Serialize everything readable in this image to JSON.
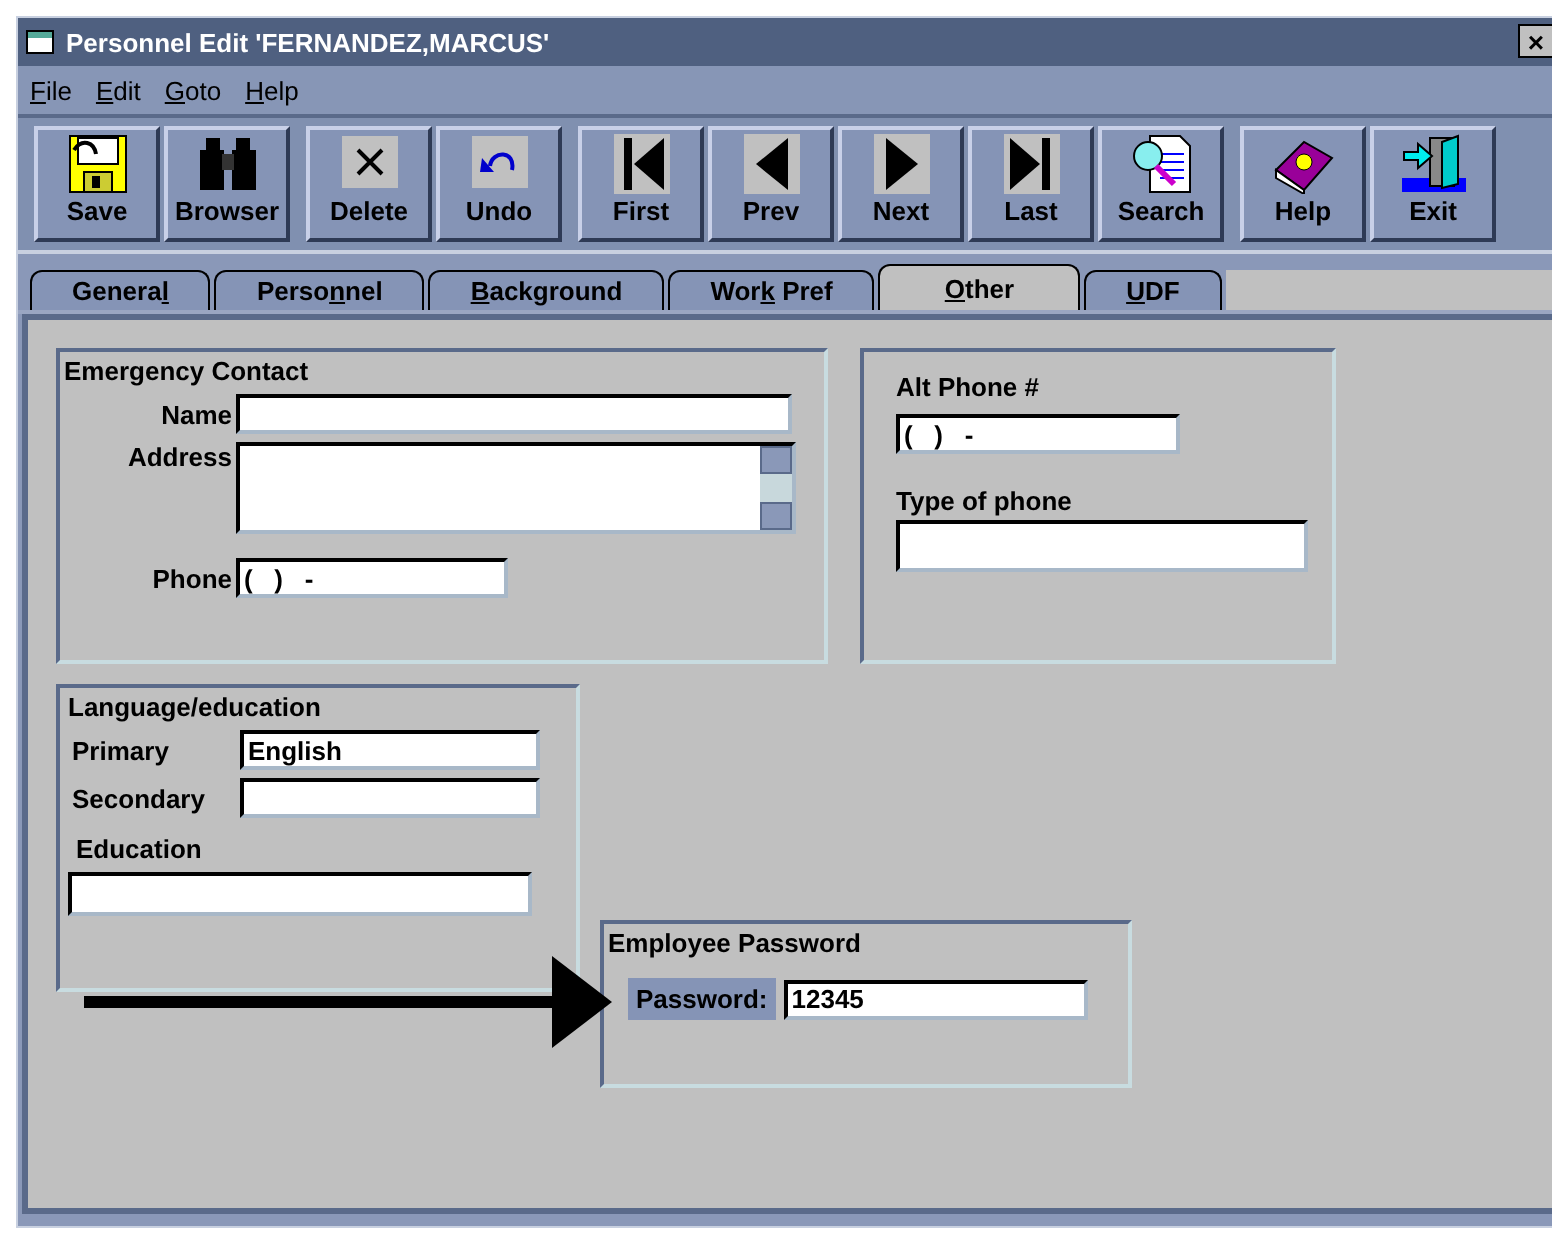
{
  "window": {
    "title": "Personnel Edit 'FERNANDEZ,MARCUS'",
    "close": "×"
  },
  "menu": [
    {
      "label": {
        "key": "F",
        "after": "ile"
      }
    },
    {
      "label": {
        "key": "E",
        "after": "dit"
      }
    },
    {
      "label": {
        "key": "G",
        "after": "oto"
      }
    },
    {
      "label": {
        "key": "H",
        "after": "elp"
      }
    }
  ],
  "toolbar": [
    [
      {
        "label": "Save",
        "kind": "save"
      },
      {
        "label": "Browser",
        "kind": "browse"
      }
    ],
    [
      {
        "label": "Delete",
        "kind": "delete"
      },
      {
        "label": "Undo",
        "kind": "undo"
      }
    ],
    [
      {
        "label": "First",
        "kind": "first"
      },
      {
        "label": "Prev",
        "kind": "prev"
      },
      {
        "label": "Next",
        "kind": "next"
      },
      {
        "label": "Last",
        "kind": "last"
      },
      {
        "label": "Search",
        "kind": "search"
      }
    ],
    [
      {
        "label": "Help",
        "kind": "help"
      },
      {
        "label": "Exit",
        "kind": "exit"
      }
    ]
  ],
  "tabs": [
    {
      "label": {
        "before": "Genera",
        "key": "l"
      },
      "selected": false
    },
    {
      "label": {
        "before": "Perso",
        "key": "n",
        "after": "nel"
      },
      "selected": false
    },
    {
      "label": {
        "key": "B",
        "after": "ackground"
      },
      "selected": false
    },
    {
      "label": {
        "before": "Wor",
        "key": "k",
        "after": " Pref"
      },
      "selected": false
    },
    {
      "label": {
        "key": "O",
        "after": "ther"
      },
      "selected": true
    },
    {
      "label": {
        "key": "U",
        "after": "DF"
      },
      "selected": false
    }
  ],
  "emergency_contact": {
    "title": "Emergency Contact",
    "name": {
      "label": "Name"
    },
    "address": {
      "label": "Address"
    },
    "phone": {
      "label": "Phone",
      "value": "(   )   -"
    }
  },
  "alt_phone": {
    "title": "Alt Phone #",
    "value": "(   )   -",
    "type_label": "Type of phone"
  },
  "language_education": {
    "title": "Language/education",
    "primary": {
      "label": "Primary",
      "value": "English"
    },
    "secondary": {
      "label": "Secondary"
    },
    "education": {
      "label": "Education"
    }
  },
  "employee_password": {
    "title": "Employee Password",
    "label": "Password:",
    "label_highlighted": true,
    "value": "12345"
  }
}
